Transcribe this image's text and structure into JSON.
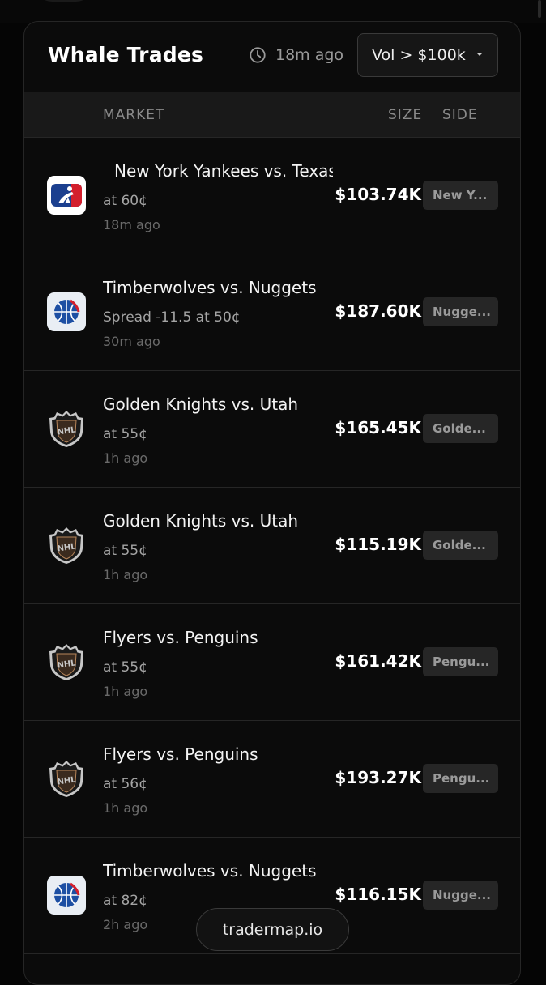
{
  "header": {
    "title": "Whale Trades",
    "updated": "18m ago",
    "filter_label": "Vol > $100k"
  },
  "columns": {
    "market": "MARKET",
    "size": "SIZE",
    "side": "SIDE"
  },
  "trades": [
    {
      "league": "mlb-logo",
      "market": "New York Yankees vs. Texas",
      "detail": "at 60¢",
      "time": "18m ago",
      "size": "$103.74K",
      "side": "New Y..."
    },
    {
      "league": "nba-logo",
      "market": "Timberwolves vs. Nuggets",
      "detail": "Spread -11.5 at 50¢",
      "time": "30m ago",
      "size": "$187.60K",
      "side": "Nugge..."
    },
    {
      "league": "nhl-logo",
      "market": "Golden Knights vs. Utah",
      "detail": "at 55¢",
      "time": "1h ago",
      "size": "$165.45K",
      "side": "Golde..."
    },
    {
      "league": "nhl-logo",
      "market": "Golden Knights vs. Utah",
      "detail": "at 55¢",
      "time": "1h ago",
      "size": "$115.19K",
      "side": "Golde..."
    },
    {
      "league": "nhl-logo",
      "market": "Flyers vs. Penguins",
      "detail": "at 55¢",
      "time": "1h ago",
      "size": "$161.42K",
      "side": "Pengu..."
    },
    {
      "league": "nhl-logo",
      "market": "Flyers vs. Penguins",
      "detail": "at 56¢",
      "time": "1h ago",
      "size": "$193.27K",
      "side": "Pengu..."
    },
    {
      "league": "nba-logo",
      "market": "Timberwolves vs. Nuggets",
      "detail": "at 82¢",
      "time": "2h ago",
      "size": "$116.15K",
      "side": "Nugge..."
    }
  ],
  "watermark": "tradermap.io",
  "colors": {
    "background": "#050505",
    "panel": "#0b0b0b",
    "border": "#262626",
    "side_badge": "#262626"
  }
}
